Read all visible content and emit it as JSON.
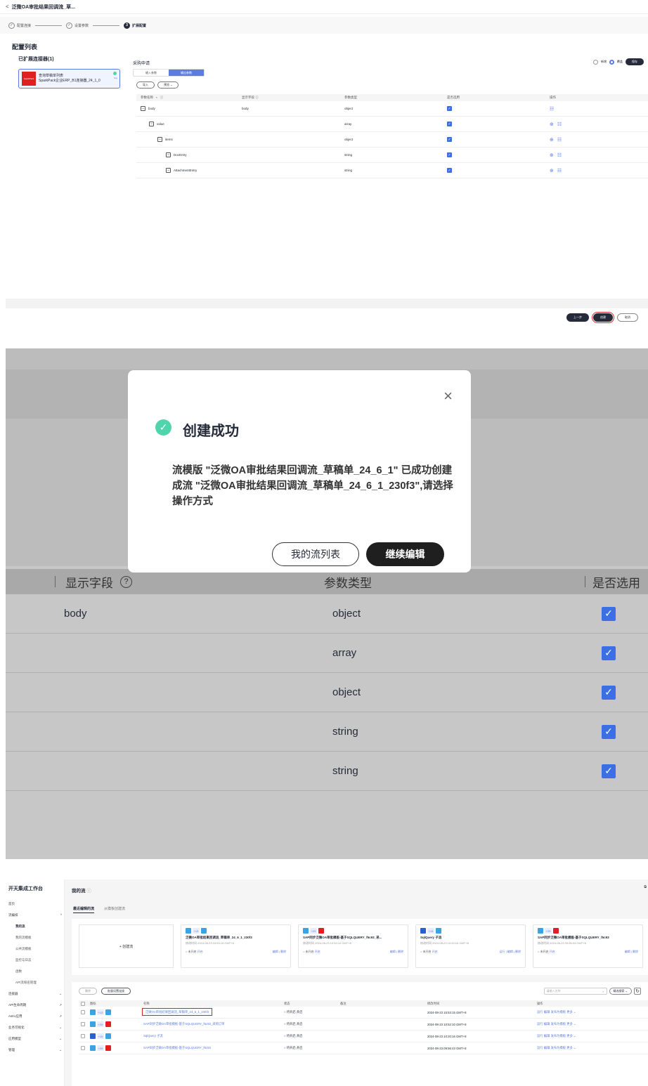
{
  "s1": {
    "back": "<",
    "title": "泛微OA审批结果回调流_草...",
    "steps": [
      "配置连接",
      "设置参数",
      "扩展配置"
    ],
    "step_nums": [
      "✓",
      "✓",
      "3"
    ],
    "section_title": "配置列表",
    "ext_title": "已扩展连接器(1)",
    "connector": {
      "logo": "SparkPack",
      "line1": "查询草稿单列表",
      "line2": "SparkPack企业ERP_B1连接器_24_1_0",
      "tag": "flog"
    },
    "category": "采购申请",
    "io_tabs": [
      "输入参数",
      "输出参数"
    ],
    "btn_import": "导入",
    "btn_preview": "预览 ⌄",
    "radio_new": "新增",
    "radio_cover": "覆盖",
    "save": "保存",
    "headers": [
      "参数名称",
      "显示字段",
      "参数类型",
      "是否选用",
      "操作"
    ],
    "rows": [
      {
        "name": "body",
        "display": "body",
        "type": "object"
      },
      {
        "name": "value",
        "display": "",
        "type": "array"
      },
      {
        "name": "items",
        "display": "",
        "type": "object"
      },
      {
        "name": "DocEntry",
        "display": "",
        "type": "string"
      },
      {
        "name": "AttachmentEntry",
        "display": "",
        "type": "string"
      }
    ],
    "prev": "上一步",
    "create": "创建",
    "cancel": "取消"
  },
  "s2": {
    "close": "×",
    "title": "创建成功",
    "body": "流模版 \"泛微OA审批结果回调流_草稿单_24_6_1\" 已成功创建成流 \"泛微OA审批结果回调流_草稿单_24_6_1_230f3\",请选择操作方式",
    "btn_list": "我的流列表",
    "btn_edit": "继续编辑",
    "bg_headers": [
      "显示字段",
      "参数类型",
      "是否选用"
    ],
    "bg_help": "?",
    "bg_rows": [
      {
        "display": "body",
        "type": "object"
      },
      {
        "display": "",
        "type": "array"
      },
      {
        "display": "",
        "type": "object"
      },
      {
        "display": "",
        "type": "string"
      },
      {
        "display": "",
        "type": "string"
      }
    ]
  },
  "s3": {
    "brand": "开天集成工作台",
    "nav": [
      {
        "label": "首页",
        "arrow": ""
      },
      {
        "label": "流编排",
        "arrow": "^"
      },
      {
        "label": "我的流",
        "arrow": "",
        "sub": true,
        "cur": true
      },
      {
        "label": "我的流模板",
        "arrow": "",
        "sub": true
      },
      {
        "label": "公共流模板",
        "arrow": "",
        "sub": true
      },
      {
        "label": "监控与日志",
        "arrow": "",
        "sub": true
      },
      {
        "label": "函数",
        "arrow": "",
        "sub": true
      },
      {
        "label": "API流域名管理",
        "arrow": "",
        "sub": true
      },
      {
        "label": "连接器",
        "arrow": "⌄"
      },
      {
        "label": "API生命周期",
        "arrow": "↗"
      },
      {
        "label": "Astro应用",
        "arrow": "↗"
      },
      {
        "label": "业务可视化",
        "arrow": "⌄"
      },
      {
        "label": "应用模型",
        "arrow": "⌄"
      },
      {
        "label": "管理",
        "arrow": "⌄"
      }
    ],
    "page_title": "我的流",
    "tabs": [
      "最近编辑的流",
      "从模板创建流"
    ],
    "new_flow": "+ 创建流",
    "cards": [
      {
        "cnt": "+13",
        "name": "泛微OA审批结果回调流_草稿单_24_6_1_230f3",
        "time": "修改时间  2024-08-23 15:53:15 GMT+8",
        "status": "○ 未开启",
        "open": "开启",
        "act": "编辑 | 删除"
      },
      {
        "cnt": "+29",
        "name": "SAP同步泛微OA审批模板-基于SQLQUERY_f5c93_采...",
        "time": "修改时间  2024-08-23 10:52:10 GMT+8",
        "status": "○ 未开启",
        "open": "开启",
        "act": "编辑 | 删除"
      },
      {
        "cnt": "+15",
        "name": "SqlQuery 子流",
        "time": "修改时间  2024-08-23 10:20:16 GMT+8",
        "status": "○ 未开启",
        "open": "开启",
        "act": "运行 | 编辑 | 删除"
      },
      {
        "cnt": "+29",
        "name": "SAP同步泛微OA审批模板-基于SQLQUERY_f5c93",
        "time": "修改时间  2024-08-23 09:56:43 GMT+8",
        "status": "○ 未开启",
        "open": "开启",
        "act": "编辑 | 删除"
      }
    ],
    "btn_delete": "删除",
    "btn_batch": "批量设置连接",
    "search_placeholder": "请输入名称",
    "search_mode": "精选搜索 ⌄",
    "list_headers": [
      "图标",
      "名称",
      "状态",
      "备注",
      "修改时间",
      "操作"
    ],
    "list_rows": [
      {
        "cnt": "+13",
        "name": "泛微OA审批结果回调流_草稿单_24_6_1_230f3",
        "status": "○ 待开启 开启",
        "time": "2024-08-23 15:53:15 GMT+8",
        "ops": "运行  编辑  发布为模板  更多 ⌄"
      },
      {
        "cnt": "+29",
        "name": "SAP同步泛微OA审批模板-基于SQLQUERY_f5c93_采购订单",
        "status": "○ 待开启 开启",
        "time": "2024-08-23 10:52:10 GMT+8",
        "ops": "运行  编辑  发布为模板  更多 ⌄"
      },
      {
        "cnt": "+15",
        "name": "SqlQuery 子流",
        "status": "○ 待开启 开启",
        "time": "2024-08-23 10:20:16 GMT+8",
        "ops": "运行  编辑  发布为模板  更多 ⌄"
      },
      {
        "cnt": "+29",
        "name": "SAP同步泛微OA审批模板-基于SQLQUERY_f5c93",
        "status": "○ 待开启 开启",
        "time": "2024-08-23 09:56:43 GMT+8",
        "ops": "运行  编辑  发布为模板  更多 ⌄"
      }
    ]
  }
}
